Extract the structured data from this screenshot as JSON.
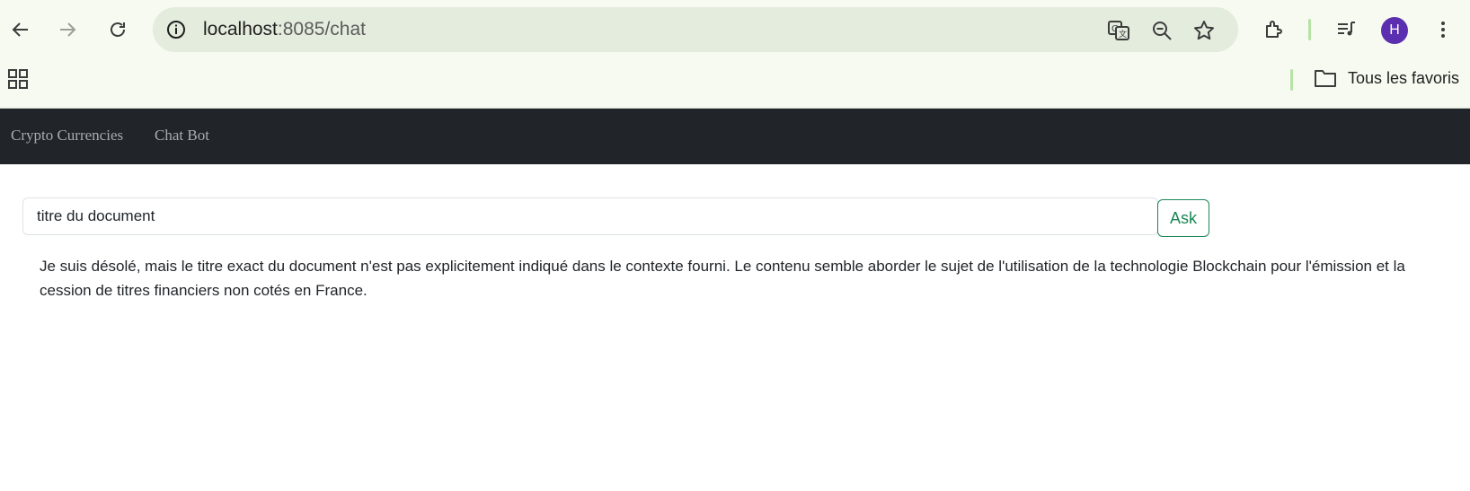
{
  "browser": {
    "url_host": "localhost",
    "url_path": ":8085/chat",
    "profile_initial": "H",
    "bookmarks_folder_label": "Tous les favoris",
    "colors": {
      "avatar": "#5b2fb0",
      "separator": "#b6e3a6"
    }
  },
  "navbar": {
    "links": [
      "Crypto Currencies",
      "Chat Bot"
    ],
    "background": "#212529"
  },
  "chat": {
    "query_value": "titre du document",
    "ask_label": "Ask",
    "answer": "Je suis désolé, mais le titre exact du document n'est pas explicitement indiqué dans le contexte fourni. Le contenu semble aborder le sujet de l'utilisation de la technologie Blockchain pour l'émission et la cession de titres financiers non cotés en France.",
    "accent": "#198754"
  }
}
